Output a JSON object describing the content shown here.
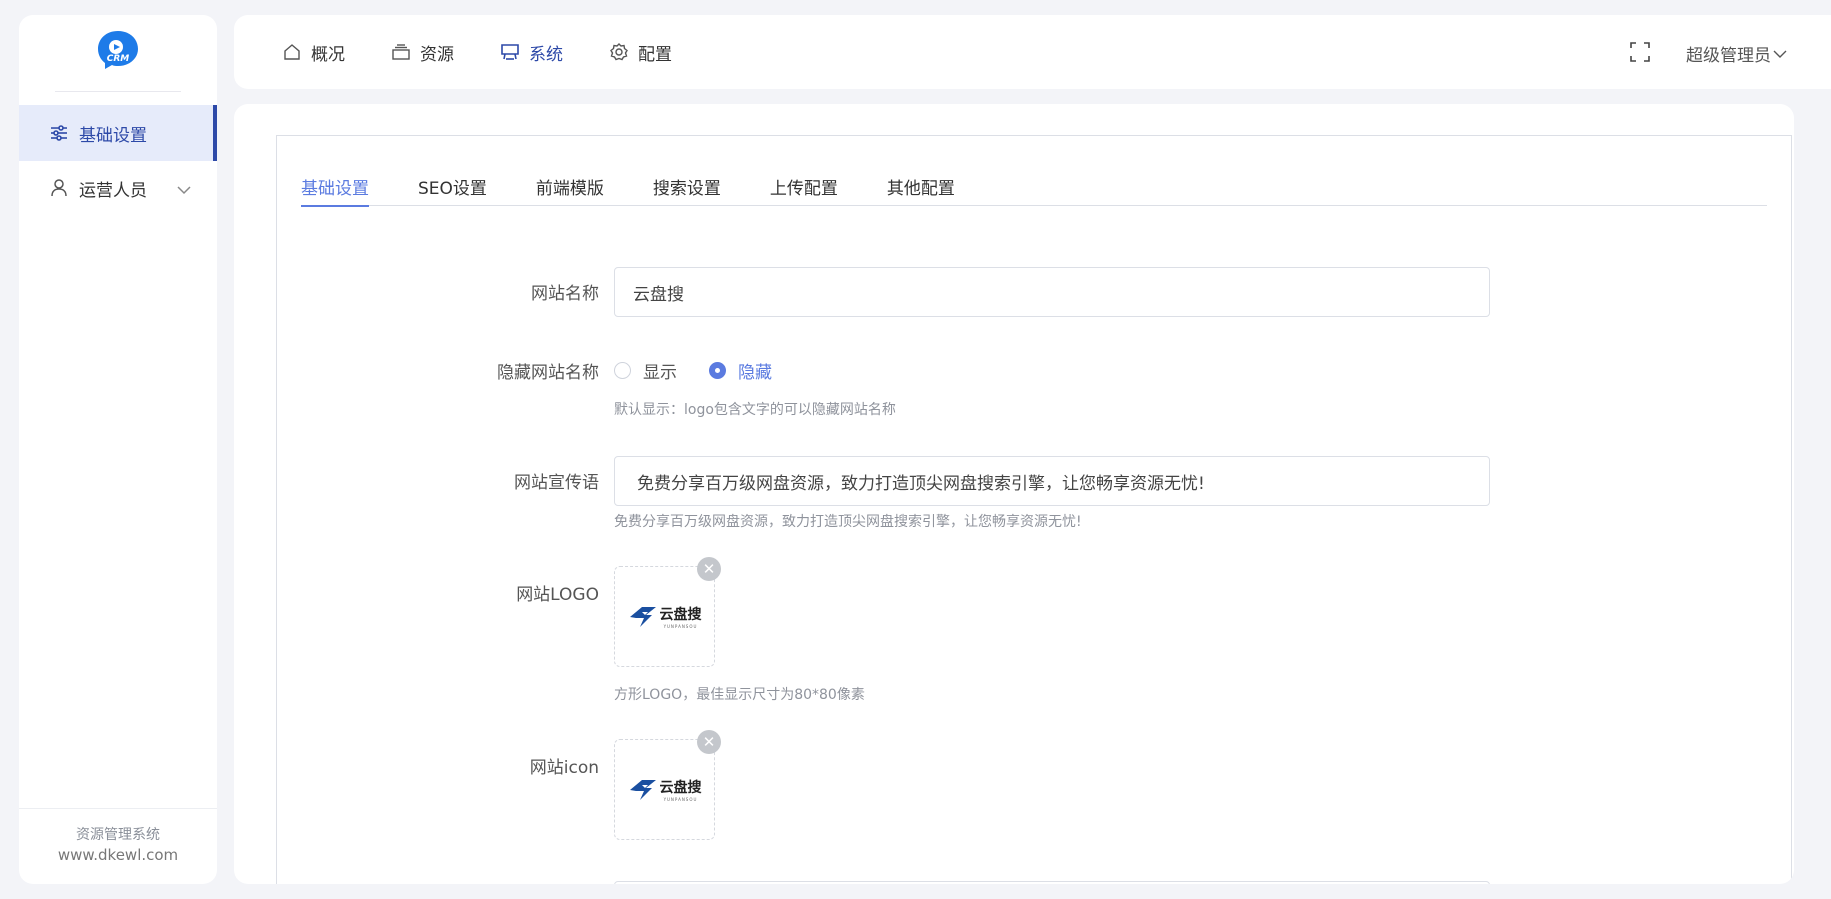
{
  "colors": {
    "primary": "#2d49a8",
    "accent": "#5b7be0",
    "background": "#f3f4f8"
  },
  "sidebar": {
    "logo_icon": "crm-logo-icon",
    "logo_text": "CRM",
    "items": [
      {
        "label": "基础设置",
        "icon": "sliders-icon",
        "active": true
      },
      {
        "label": "运营人员",
        "icon": "user-icon",
        "active": false
      }
    ],
    "footer": {
      "line1": "资源管理系统",
      "line2": "www.dkewl.com"
    }
  },
  "topbar": {
    "nav": [
      {
        "label": "概况",
        "icon": "home-icon"
      },
      {
        "label": "资源",
        "icon": "layers-icon"
      },
      {
        "label": "系统",
        "icon": "monitor-icon",
        "active": true
      },
      {
        "label": "配置",
        "icon": "gear-icon"
      }
    ],
    "fullscreen_icon": "fullscreen-icon",
    "user": "超级管理员"
  },
  "tabs": [
    {
      "label": "基础设置",
      "active": true
    },
    {
      "label": "SEO设置"
    },
    {
      "label": "前端模版"
    },
    {
      "label": "搜索设置"
    },
    {
      "label": "上传配置"
    },
    {
      "label": "其他配置"
    }
  ],
  "form": {
    "site_name": {
      "label": "网站名称",
      "value": "云盘搜"
    },
    "hide_name": {
      "label": "隐藏网站名称",
      "options": [
        {
          "label": "显示",
          "checked": false
        },
        {
          "label": "隐藏",
          "checked": true
        }
      ],
      "hint": "默认显示：logo包含文字的可以隐藏网站名称"
    },
    "slogan": {
      "label": "网站宣传语",
      "value": "免费分享百万级网盘资源，致力打造顶尖网盘搜索引擎，让您畅享资源无忧!",
      "hint": "免费分享百万级网盘资源，致力打造顶尖网盘搜索引擎，让您畅享资源无忧!"
    },
    "logo": {
      "label": "网站LOGO",
      "image_cn": "云盘搜",
      "image_en": "YUNPANSOU",
      "hint": "方形LOGO，最佳显示尺寸为80*80像素"
    },
    "icon": {
      "label": "网站icon",
      "image_cn": "云盘搜",
      "image_en": "YUNPANSOU"
    }
  }
}
